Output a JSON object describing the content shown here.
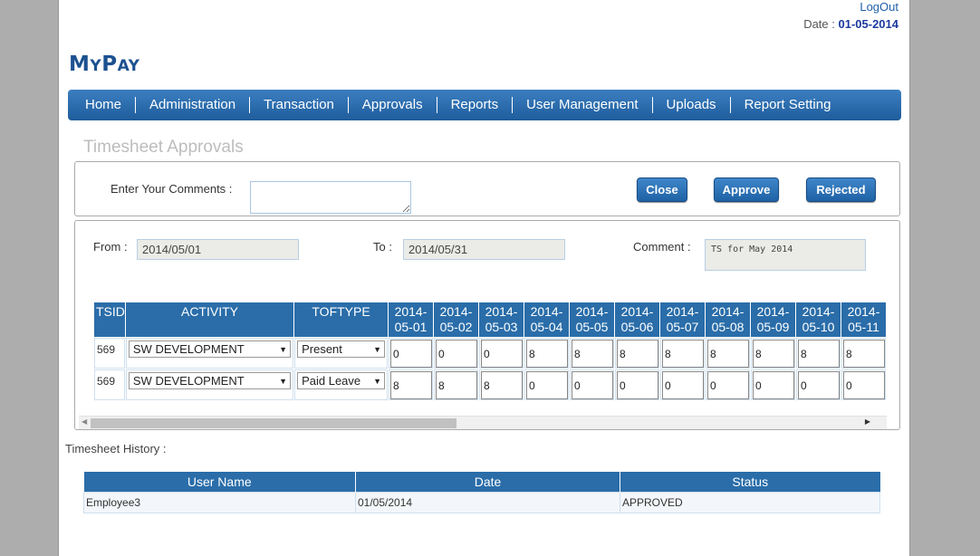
{
  "header": {
    "logout": "LogOut",
    "date_label": "Date :",
    "date_value": "01-05-2014"
  },
  "logo": {
    "big1": "M",
    "small1": "Y",
    "big2": "P",
    "small2": "AY"
  },
  "nav": [
    "Home",
    "Administration",
    "Transaction",
    "Approvals",
    "Reports",
    "User Management",
    "Uploads",
    "Report Setting"
  ],
  "page_title": "Timesheet Approvals",
  "comments": {
    "label": "Enter Your Comments :",
    "value": ""
  },
  "buttons": {
    "close": "Close",
    "approve": "Approve",
    "rejected": "Rejected"
  },
  "filters": {
    "from_label": "From :",
    "from_value": "2014/05/01",
    "to_label": "To :",
    "to_value": "2014/05/31",
    "comment_label": "Comment :",
    "comment_value": "TS for May 2014"
  },
  "grid": {
    "headers": {
      "tsid": "TSID",
      "activity": "ACTIVITY",
      "toftype": "TOFTYPE"
    },
    "dates": [
      [
        "2014-",
        "05-01"
      ],
      [
        "2014-",
        "05-02"
      ],
      [
        "2014-",
        "05-03"
      ],
      [
        "2014-",
        "05-04"
      ],
      [
        "2014-",
        "05-05"
      ],
      [
        "2014-",
        "05-06"
      ],
      [
        "2014-",
        "05-07"
      ],
      [
        "2014-",
        "05-08"
      ],
      [
        "2014-",
        "05-09"
      ],
      [
        "2014-",
        "05-10"
      ],
      [
        "2014-",
        "05-11"
      ]
    ],
    "rows": [
      {
        "tsid": "569",
        "activity": "SW DEVELOPMENT",
        "toftype": "Present",
        "hours": [
          "0",
          "0",
          "0",
          "8",
          "8",
          "8",
          "8",
          "8",
          "8",
          "8",
          "8"
        ]
      },
      {
        "tsid": "569",
        "activity": "SW DEVELOPMENT",
        "toftype": "Paid Leave",
        "hours": [
          "8",
          "8",
          "8",
          "0",
          "0",
          "0",
          "0",
          "0",
          "0",
          "0",
          "0"
        ]
      }
    ]
  },
  "history": {
    "label": "Timesheet History :",
    "headers": [
      "User Name",
      "Date",
      "Status"
    ],
    "rows": [
      [
        "Employee3",
        "01/05/2014",
        "APPROVED"
      ]
    ]
  },
  "colors": {
    "nav_bg": "#2a6da9",
    "header_bg": "#2a6da9",
    "date_value": "#1b3aa0",
    "button_bg": "#2a6fb0"
  }
}
